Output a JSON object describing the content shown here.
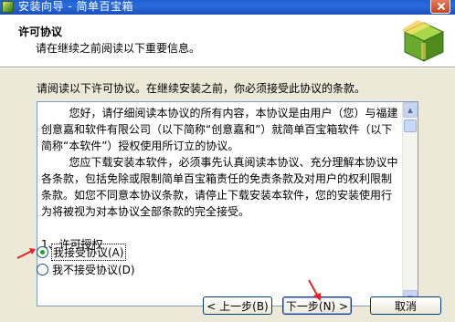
{
  "window": {
    "title": "安装向导 - 简单百宝箱"
  },
  "header": {
    "title": "许可协议",
    "subtitle": "请在继续之前阅读以下重要信息。"
  },
  "main": {
    "intro": "请阅读以下许可协议。在继续安装之前，你必须接受此协议的条款。",
    "license_text": "        您好，请仔细阅读本协议的所有内容，本协议是由用户（您）与福建创意嘉和软件有限公司（以下简称“创意嘉和”）就简单百宝箱软件（以下简称“本软件”）授权使用所订立的协议。\n        您应下载安装本软件，必须事先认真阅读本协议、充分理解本协议中各条款，包括免除或限制简单百宝箱责任的免责条款及对用户的权利限制条款。如您不同意本协议条款，请停止下载安装本软件，您的安装使用行为将被视为对本协议全部条款的完全接受。\n\n1、许可授权",
    "options": {
      "accept_label": "我接受协议(A)",
      "decline_label": "我不接受协议(D)",
      "selected": "accept"
    }
  },
  "footer": {
    "back_label": "< 上一步(B)",
    "next_label": "下一步(N) >",
    "cancel_label": "取消"
  },
  "colors": {
    "titlebar": "#2a6be0",
    "dialog_bg": "#ece9d8",
    "arrow": "#e8231f"
  }
}
